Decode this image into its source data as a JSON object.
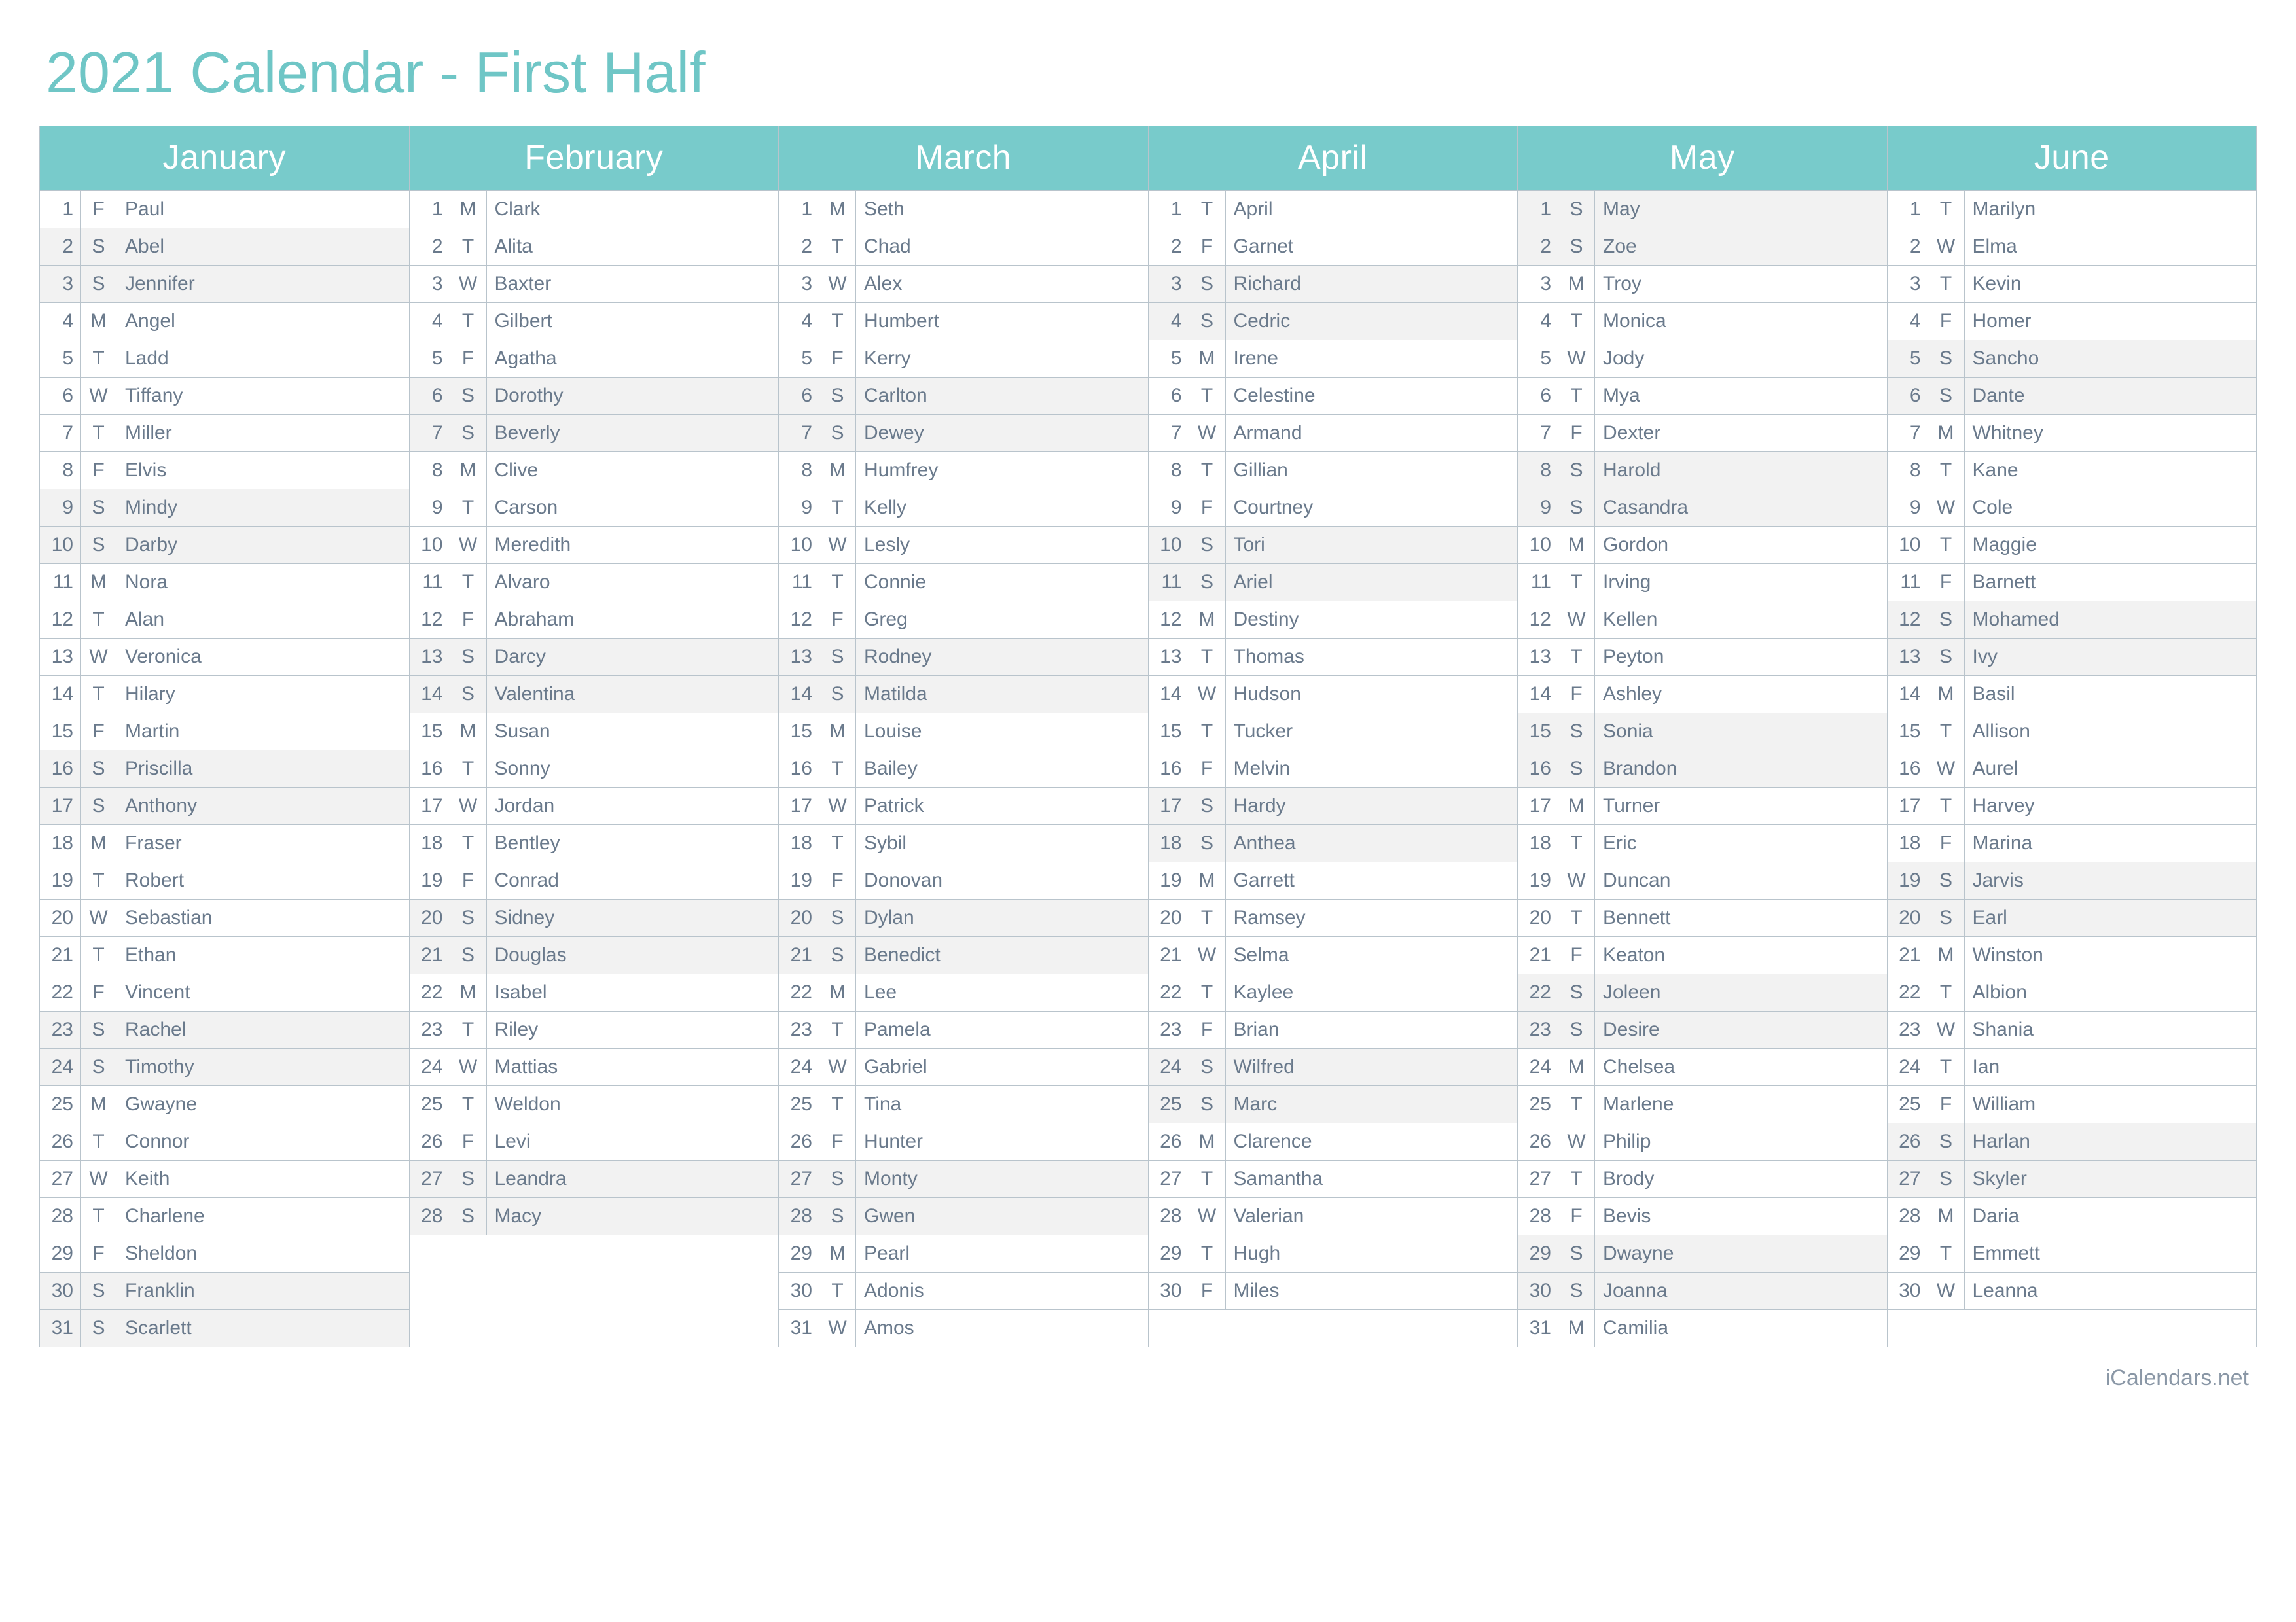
{
  "title": "2021 Calendar - First Half",
  "footer": "iCalendars.net",
  "weekendDows": [
    "S"
  ],
  "maxDays": 31,
  "months": [
    {
      "name": "January",
      "days": [
        {
          "n": 1,
          "dow": "F",
          "name": "Paul"
        },
        {
          "n": 2,
          "dow": "S",
          "name": "Abel"
        },
        {
          "n": 3,
          "dow": "S",
          "name": "Jennifer"
        },
        {
          "n": 4,
          "dow": "M",
          "name": "Angel"
        },
        {
          "n": 5,
          "dow": "T",
          "name": "Ladd"
        },
        {
          "n": 6,
          "dow": "W",
          "name": "Tiffany"
        },
        {
          "n": 7,
          "dow": "T",
          "name": "Miller"
        },
        {
          "n": 8,
          "dow": "F",
          "name": "Elvis"
        },
        {
          "n": 9,
          "dow": "S",
          "name": "Mindy"
        },
        {
          "n": 10,
          "dow": "S",
          "name": "Darby"
        },
        {
          "n": 11,
          "dow": "M",
          "name": "Nora"
        },
        {
          "n": 12,
          "dow": "T",
          "name": "Alan"
        },
        {
          "n": 13,
          "dow": "W",
          "name": "Veronica"
        },
        {
          "n": 14,
          "dow": "T",
          "name": "Hilary"
        },
        {
          "n": 15,
          "dow": "F",
          "name": "Martin"
        },
        {
          "n": 16,
          "dow": "S",
          "name": "Priscilla"
        },
        {
          "n": 17,
          "dow": "S",
          "name": "Anthony"
        },
        {
          "n": 18,
          "dow": "M",
          "name": "Fraser"
        },
        {
          "n": 19,
          "dow": "T",
          "name": "Robert"
        },
        {
          "n": 20,
          "dow": "W",
          "name": "Sebastian"
        },
        {
          "n": 21,
          "dow": "T",
          "name": "Ethan"
        },
        {
          "n": 22,
          "dow": "F",
          "name": "Vincent"
        },
        {
          "n": 23,
          "dow": "S",
          "name": "Rachel"
        },
        {
          "n": 24,
          "dow": "S",
          "name": "Timothy"
        },
        {
          "n": 25,
          "dow": "M",
          "name": "Gwayne"
        },
        {
          "n": 26,
          "dow": "T",
          "name": "Connor"
        },
        {
          "n": 27,
          "dow": "W",
          "name": "Keith"
        },
        {
          "n": 28,
          "dow": "T",
          "name": "Charlene"
        },
        {
          "n": 29,
          "dow": "F",
          "name": "Sheldon"
        },
        {
          "n": 30,
          "dow": "S",
          "name": "Franklin"
        },
        {
          "n": 31,
          "dow": "S",
          "name": "Scarlett"
        }
      ]
    },
    {
      "name": "February",
      "days": [
        {
          "n": 1,
          "dow": "M",
          "name": "Clark"
        },
        {
          "n": 2,
          "dow": "T",
          "name": "Alita"
        },
        {
          "n": 3,
          "dow": "W",
          "name": "Baxter"
        },
        {
          "n": 4,
          "dow": "T",
          "name": "Gilbert"
        },
        {
          "n": 5,
          "dow": "F",
          "name": "Agatha"
        },
        {
          "n": 6,
          "dow": "S",
          "name": "Dorothy"
        },
        {
          "n": 7,
          "dow": "S",
          "name": "Beverly"
        },
        {
          "n": 8,
          "dow": "M",
          "name": "Clive"
        },
        {
          "n": 9,
          "dow": "T",
          "name": "Carson"
        },
        {
          "n": 10,
          "dow": "W",
          "name": "Meredith"
        },
        {
          "n": 11,
          "dow": "T",
          "name": "Alvaro"
        },
        {
          "n": 12,
          "dow": "F",
          "name": "Abraham"
        },
        {
          "n": 13,
          "dow": "S",
          "name": "Darcy"
        },
        {
          "n": 14,
          "dow": "S",
          "name": "Valentina"
        },
        {
          "n": 15,
          "dow": "M",
          "name": "Susan"
        },
        {
          "n": 16,
          "dow": "T",
          "name": "Sonny"
        },
        {
          "n": 17,
          "dow": "W",
          "name": "Jordan"
        },
        {
          "n": 18,
          "dow": "T",
          "name": "Bentley"
        },
        {
          "n": 19,
          "dow": "F",
          "name": "Conrad"
        },
        {
          "n": 20,
          "dow": "S",
          "name": "Sidney"
        },
        {
          "n": 21,
          "dow": "S",
          "name": "Douglas"
        },
        {
          "n": 22,
          "dow": "M",
          "name": "Isabel"
        },
        {
          "n": 23,
          "dow": "T",
          "name": "Riley"
        },
        {
          "n": 24,
          "dow": "W",
          "name": "Mattias"
        },
        {
          "n": 25,
          "dow": "T",
          "name": "Weldon"
        },
        {
          "n": 26,
          "dow": "F",
          "name": "Levi"
        },
        {
          "n": 27,
          "dow": "S",
          "name": "Leandra"
        },
        {
          "n": 28,
          "dow": "S",
          "name": "Macy"
        }
      ]
    },
    {
      "name": "March",
      "days": [
        {
          "n": 1,
          "dow": "M",
          "name": "Seth"
        },
        {
          "n": 2,
          "dow": "T",
          "name": "Chad"
        },
        {
          "n": 3,
          "dow": "W",
          "name": "Alex"
        },
        {
          "n": 4,
          "dow": "T",
          "name": "Humbert"
        },
        {
          "n": 5,
          "dow": "F",
          "name": "Kerry"
        },
        {
          "n": 6,
          "dow": "S",
          "name": "Carlton"
        },
        {
          "n": 7,
          "dow": "S",
          "name": "Dewey"
        },
        {
          "n": 8,
          "dow": "M",
          "name": "Humfrey"
        },
        {
          "n": 9,
          "dow": "T",
          "name": "Kelly"
        },
        {
          "n": 10,
          "dow": "W",
          "name": "Lesly"
        },
        {
          "n": 11,
          "dow": "T",
          "name": "Connie"
        },
        {
          "n": 12,
          "dow": "F",
          "name": "Greg"
        },
        {
          "n": 13,
          "dow": "S",
          "name": "Rodney"
        },
        {
          "n": 14,
          "dow": "S",
          "name": "Matilda"
        },
        {
          "n": 15,
          "dow": "M",
          "name": "Louise"
        },
        {
          "n": 16,
          "dow": "T",
          "name": "Bailey"
        },
        {
          "n": 17,
          "dow": "W",
          "name": "Patrick"
        },
        {
          "n": 18,
          "dow": "T",
          "name": "Sybil"
        },
        {
          "n": 19,
          "dow": "F",
          "name": "Donovan"
        },
        {
          "n": 20,
          "dow": "S",
          "name": "Dylan"
        },
        {
          "n": 21,
          "dow": "S",
          "name": "Benedict"
        },
        {
          "n": 22,
          "dow": "M",
          "name": "Lee"
        },
        {
          "n": 23,
          "dow": "T",
          "name": "Pamela"
        },
        {
          "n": 24,
          "dow": "W",
          "name": "Gabriel"
        },
        {
          "n": 25,
          "dow": "T",
          "name": "Tina"
        },
        {
          "n": 26,
          "dow": "F",
          "name": "Hunter"
        },
        {
          "n": 27,
          "dow": "S",
          "name": "Monty"
        },
        {
          "n": 28,
          "dow": "S",
          "name": "Gwen"
        },
        {
          "n": 29,
          "dow": "M",
          "name": "Pearl"
        },
        {
          "n": 30,
          "dow": "T",
          "name": "Adonis"
        },
        {
          "n": 31,
          "dow": "W",
          "name": "Amos"
        }
      ]
    },
    {
      "name": "April",
      "days": [
        {
          "n": 1,
          "dow": "T",
          "name": "April"
        },
        {
          "n": 2,
          "dow": "F",
          "name": "Garnet"
        },
        {
          "n": 3,
          "dow": "S",
          "name": "Richard"
        },
        {
          "n": 4,
          "dow": "S",
          "name": "Cedric"
        },
        {
          "n": 5,
          "dow": "M",
          "name": "Irene"
        },
        {
          "n": 6,
          "dow": "T",
          "name": "Celestine"
        },
        {
          "n": 7,
          "dow": "W",
          "name": "Armand"
        },
        {
          "n": 8,
          "dow": "T",
          "name": "Gillian"
        },
        {
          "n": 9,
          "dow": "F",
          "name": "Courtney"
        },
        {
          "n": 10,
          "dow": "S",
          "name": "Tori"
        },
        {
          "n": 11,
          "dow": "S",
          "name": "Ariel"
        },
        {
          "n": 12,
          "dow": "M",
          "name": "Destiny"
        },
        {
          "n": 13,
          "dow": "T",
          "name": "Thomas"
        },
        {
          "n": 14,
          "dow": "W",
          "name": "Hudson"
        },
        {
          "n": 15,
          "dow": "T",
          "name": "Tucker"
        },
        {
          "n": 16,
          "dow": "F",
          "name": "Melvin"
        },
        {
          "n": 17,
          "dow": "S",
          "name": "Hardy"
        },
        {
          "n": 18,
          "dow": "S",
          "name": "Anthea"
        },
        {
          "n": 19,
          "dow": "M",
          "name": "Garrett"
        },
        {
          "n": 20,
          "dow": "T",
          "name": "Ramsey"
        },
        {
          "n": 21,
          "dow": "W",
          "name": "Selma"
        },
        {
          "n": 22,
          "dow": "T",
          "name": "Kaylee"
        },
        {
          "n": 23,
          "dow": "F",
          "name": "Brian"
        },
        {
          "n": 24,
          "dow": "S",
          "name": "Wilfred"
        },
        {
          "n": 25,
          "dow": "S",
          "name": "Marc"
        },
        {
          "n": 26,
          "dow": "M",
          "name": "Clarence"
        },
        {
          "n": 27,
          "dow": "T",
          "name": "Samantha"
        },
        {
          "n": 28,
          "dow": "W",
          "name": "Valerian"
        },
        {
          "n": 29,
          "dow": "T",
          "name": "Hugh"
        },
        {
          "n": 30,
          "dow": "F",
          "name": "Miles"
        }
      ]
    },
    {
      "name": "May",
      "days": [
        {
          "n": 1,
          "dow": "S",
          "name": "May"
        },
        {
          "n": 2,
          "dow": "S",
          "name": "Zoe"
        },
        {
          "n": 3,
          "dow": "M",
          "name": "Troy"
        },
        {
          "n": 4,
          "dow": "T",
          "name": "Monica"
        },
        {
          "n": 5,
          "dow": "W",
          "name": "Jody"
        },
        {
          "n": 6,
          "dow": "T",
          "name": "Mya"
        },
        {
          "n": 7,
          "dow": "F",
          "name": "Dexter"
        },
        {
          "n": 8,
          "dow": "S",
          "name": "Harold"
        },
        {
          "n": 9,
          "dow": "S",
          "name": "Casandra"
        },
        {
          "n": 10,
          "dow": "M",
          "name": "Gordon"
        },
        {
          "n": 11,
          "dow": "T",
          "name": "Irving"
        },
        {
          "n": 12,
          "dow": "W",
          "name": "Kellen"
        },
        {
          "n": 13,
          "dow": "T",
          "name": "Peyton"
        },
        {
          "n": 14,
          "dow": "F",
          "name": "Ashley"
        },
        {
          "n": 15,
          "dow": "S",
          "name": "Sonia"
        },
        {
          "n": 16,
          "dow": "S",
          "name": "Brandon"
        },
        {
          "n": 17,
          "dow": "M",
          "name": "Turner"
        },
        {
          "n": 18,
          "dow": "T",
          "name": "Eric"
        },
        {
          "n": 19,
          "dow": "W",
          "name": "Duncan"
        },
        {
          "n": 20,
          "dow": "T",
          "name": "Bennett"
        },
        {
          "n": 21,
          "dow": "F",
          "name": "Keaton"
        },
        {
          "n": 22,
          "dow": "S",
          "name": "Joleen"
        },
        {
          "n": 23,
          "dow": "S",
          "name": "Desire"
        },
        {
          "n": 24,
          "dow": "M",
          "name": "Chelsea"
        },
        {
          "n": 25,
          "dow": "T",
          "name": "Marlene"
        },
        {
          "n": 26,
          "dow": "W",
          "name": "Philip"
        },
        {
          "n": 27,
          "dow": "T",
          "name": "Brody"
        },
        {
          "n": 28,
          "dow": "F",
          "name": "Bevis"
        },
        {
          "n": 29,
          "dow": "S",
          "name": "Dwayne"
        },
        {
          "n": 30,
          "dow": "S",
          "name": "Joanna"
        },
        {
          "n": 31,
          "dow": "M",
          "name": "Camilia"
        }
      ]
    },
    {
      "name": "June",
      "days": [
        {
          "n": 1,
          "dow": "T",
          "name": "Marilyn"
        },
        {
          "n": 2,
          "dow": "W",
          "name": "Elma"
        },
        {
          "n": 3,
          "dow": "T",
          "name": "Kevin"
        },
        {
          "n": 4,
          "dow": "F",
          "name": "Homer"
        },
        {
          "n": 5,
          "dow": "S",
          "name": "Sancho"
        },
        {
          "n": 6,
          "dow": "S",
          "name": "Dante"
        },
        {
          "n": 7,
          "dow": "M",
          "name": "Whitney"
        },
        {
          "n": 8,
          "dow": "T",
          "name": "Kane"
        },
        {
          "n": 9,
          "dow": "W",
          "name": "Cole"
        },
        {
          "n": 10,
          "dow": "T",
          "name": "Maggie"
        },
        {
          "n": 11,
          "dow": "F",
          "name": "Barnett"
        },
        {
          "n": 12,
          "dow": "S",
          "name": "Mohamed"
        },
        {
          "n": 13,
          "dow": "S",
          "name": "Ivy"
        },
        {
          "n": 14,
          "dow": "M",
          "name": "Basil"
        },
        {
          "n": 15,
          "dow": "T",
          "name": "Allison"
        },
        {
          "n": 16,
          "dow": "W",
          "name": "Aurel"
        },
        {
          "n": 17,
          "dow": "T",
          "name": "Harvey"
        },
        {
          "n": 18,
          "dow": "F",
          "name": "Marina"
        },
        {
          "n": 19,
          "dow": "S",
          "name": "Jarvis"
        },
        {
          "n": 20,
          "dow": "S",
          "name": "Earl"
        },
        {
          "n": 21,
          "dow": "M",
          "name": "Winston"
        },
        {
          "n": 22,
          "dow": "T",
          "name": "Albion"
        },
        {
          "n": 23,
          "dow": "W",
          "name": "Shania"
        },
        {
          "n": 24,
          "dow": "T",
          "name": "Ian"
        },
        {
          "n": 25,
          "dow": "F",
          "name": "William"
        },
        {
          "n": 26,
          "dow": "S",
          "name": "Harlan"
        },
        {
          "n": 27,
          "dow": "S",
          "name": "Skyler"
        },
        {
          "n": 28,
          "dow": "M",
          "name": "Daria"
        },
        {
          "n": 29,
          "dow": "T",
          "name": "Emmett"
        },
        {
          "n": 30,
          "dow": "W",
          "name": "Leanna"
        }
      ]
    }
  ]
}
